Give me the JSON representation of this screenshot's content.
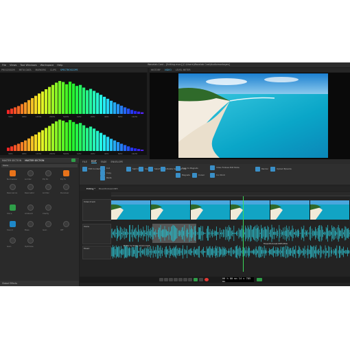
{
  "window": {
    "title": "Wavelab Cast – [Editing.mon] [C:\\Users\\Wavelab Cast\\Audiomontages]"
  },
  "menu": [
    "File",
    "Views",
    "Tool Windows",
    "Workspace",
    "Help"
  ],
  "top_left_tabs": [
    {
      "label": "PROCESSOR",
      "active": false
    },
    {
      "label": "META DATA",
      "active": false
    },
    {
      "label": "MARKERS",
      "active": false
    },
    {
      "label": "CLIPS",
      "active": false
    },
    {
      "label": "SPECTROSCOPE",
      "active": true
    }
  ],
  "top_right_tabs": [
    {
      "label": "HISTORY",
      "active": false
    },
    {
      "label": "VIDEO",
      "active": true
    },
    {
      "label": "LEVEL METER",
      "active": false
    }
  ],
  "spectrum": {
    "freq_labels": [
      "31Hz",
      "63Hz",
      "125Hz",
      "250Hz",
      "500Hz",
      "1kHz",
      "2kHz",
      "4kHz",
      "8kHz",
      "16kHz"
    ],
    "row1_values": [
      0.12,
      0.16,
      0.2,
      0.24,
      0.3,
      0.35,
      0.42,
      0.48,
      0.55,
      0.62,
      0.68,
      0.75,
      0.82,
      0.88,
      0.95,
      1.0,
      0.97,
      0.9,
      0.98,
      0.92,
      0.85,
      0.88,
      0.8,
      0.72,
      0.76,
      0.7,
      0.64,
      0.58,
      0.52,
      0.46,
      0.4,
      0.35,
      0.3,
      0.25,
      0.2,
      0.16,
      0.12,
      0.09,
      0.07,
      0.05
    ],
    "row2_values": [
      0.1,
      0.14,
      0.18,
      0.22,
      0.27,
      0.32,
      0.38,
      0.45,
      0.5,
      0.57,
      0.63,
      0.7,
      0.76,
      0.83,
      0.9,
      0.95,
      0.92,
      0.87,
      0.94,
      0.88,
      0.82,
      0.85,
      0.78,
      0.7,
      0.74,
      0.68,
      0.61,
      0.55,
      0.49,
      0.43,
      0.37,
      0.32,
      0.27,
      0.22,
      0.18,
      0.14,
      0.1,
      0.08,
      0.06,
      0.04
    ]
  },
  "left_panel": {
    "tabs": [
      "MASTER SECTION",
      "MASTER SECTION"
    ],
    "section_label": "Voice",
    "controls": [
      {
        "label": "Normalizer"
      },
      {
        "label": "Limiter"
      },
      {
        "label": "EQ Ex"
      },
      {
        "label": "EQ Fx"
      },
      {
        "label": "Resonance"
      },
      {
        "label": "Resonator"
      },
      {
        "label": "Limiter"
      },
      {
        "label": "Denoiser"
      },
      {
        "label": "Voice"
      },
      {
        "label": "Ambient"
      },
      {
        "label": "Clarity"
      },
      {
        "label": "Sound"
      },
      {
        "label": "Bass"
      },
      {
        "label": "Gain"
      },
      {
        "label": "Off"
      },
      {
        "label": "Gain"
      },
      {
        "label": "Optimize"
      }
    ],
    "footer": "Global Effects"
  },
  "editor": {
    "tabs": [
      {
        "label": "FILE",
        "active": false
      },
      {
        "label": "EDIT",
        "active": true
      },
      {
        "label": "FADE",
        "active": false
      },
      {
        "label": "ENVELOPE",
        "active": false
      }
    ],
    "ribbon": [
      "Edit Content",
      "Cut",
      "Copy",
      "Paste",
      "Split Clip",
      "Sound",
      "Select Audio",
      "Delete Selected Clip",
      "Snap to Magnets",
      "Magnets",
      "Cursor",
      "Video Follows Edit Mode",
      "Cur Point",
      "Render",
      "Upload Episode"
    ],
    "clip_tabs": [
      "Editing *",
      "MusicPodcast-MP3"
    ],
    "tracks": [
      {
        "name": "Video track"
      },
      {
        "name": "Voice"
      },
      {
        "name": "Music"
      }
    ],
    "clip_labels": [
      "Editor & Voice of Siri.mp4",
      "MusicPodcast-MP3.M4A"
    ],
    "timecode": "00 h 00 mn 14 s 785 ms"
  },
  "colors": {
    "accent": "#4fc3f7",
    "waveform": "#2bb3c0",
    "playhead": "#3cdc5a",
    "record": "#e53935"
  }
}
